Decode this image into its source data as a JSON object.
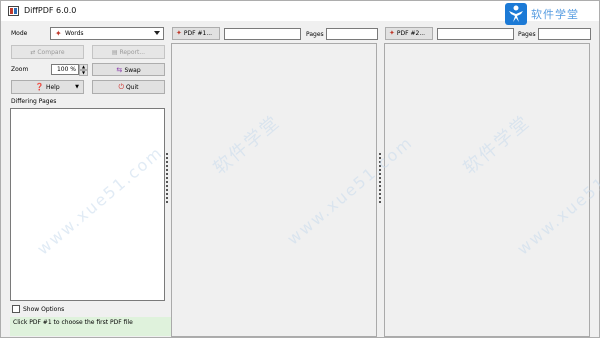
{
  "window": {
    "title": "DiffPDF 6.0.0"
  },
  "watermark": {
    "site_text": "软件学堂",
    "url_text": "www.xue51.com",
    "cn_text": "软件学堂"
  },
  "controls": {
    "mode_label": "Mode",
    "mode_value": "Words",
    "compare_label": "Compare",
    "report_label": "Report...",
    "zoom_label": "Zoom",
    "zoom_value": "100 %",
    "swap_label": "Swap",
    "help_label": "Help",
    "quit_label": "Quit",
    "differing_pages_label": "Differing Pages",
    "show_options_label": "Show Options"
  },
  "status": {
    "text": "Click PDF #1 to choose the first PDF file"
  },
  "pdf1": {
    "button_label": "PDF #1...",
    "pages_label": "Pages",
    "file_value": "",
    "pages_value": ""
  },
  "pdf2": {
    "button_label": "PDF #2...",
    "pages_label": "Pages",
    "file_value": "",
    "pages_value": ""
  }
}
